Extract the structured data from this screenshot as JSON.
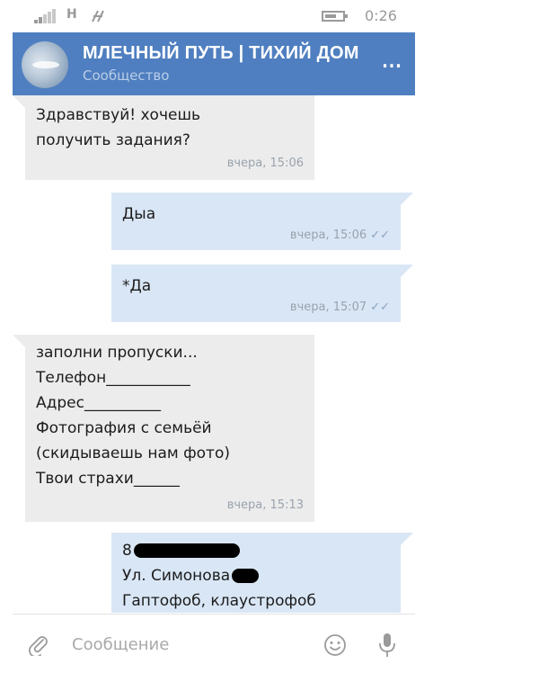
{
  "status_bar": {
    "network_letter": "H",
    "network_icon": "signal-transfer-icon",
    "time": "0:26"
  },
  "header": {
    "title": "МЛЕЧНЫЙ ПУТЬ | ТИХИЙ ДОМ",
    "subtitle": "Сообщество",
    "more_label": "...",
    "accent_color": "#4f7fc0"
  },
  "messages": [
    {
      "direction": "in",
      "text": "Здравствуй! хочешь\nполучить задания?",
      "time": "вчера, 15:06"
    },
    {
      "direction": "out",
      "text": "Дыа",
      "time": "вчера, 15:06",
      "read_ticks": "✓✓"
    },
    {
      "direction": "out",
      "text": "*Да",
      "time": "вчера, 15:07",
      "read_ticks": "✓✓"
    },
    {
      "direction": "in",
      "text": "заполни пропуски...\nТелефон___________\nАдрес__________\nФотография с семьёй\n(скидываешь нам фото)\nТвои страхи______",
      "time": "вчера, 15:13"
    },
    {
      "direction": "out",
      "line1_prefix": "8",
      "line2_prefix": "Ул. Симонова",
      "line3": "Гаптофоб, клаустрофоб"
    }
  ],
  "input": {
    "placeholder": "Сообщение"
  },
  "icons": {
    "attach": "paperclip-icon",
    "emoji": "emoji-icon",
    "mic": "microphone-icon"
  }
}
